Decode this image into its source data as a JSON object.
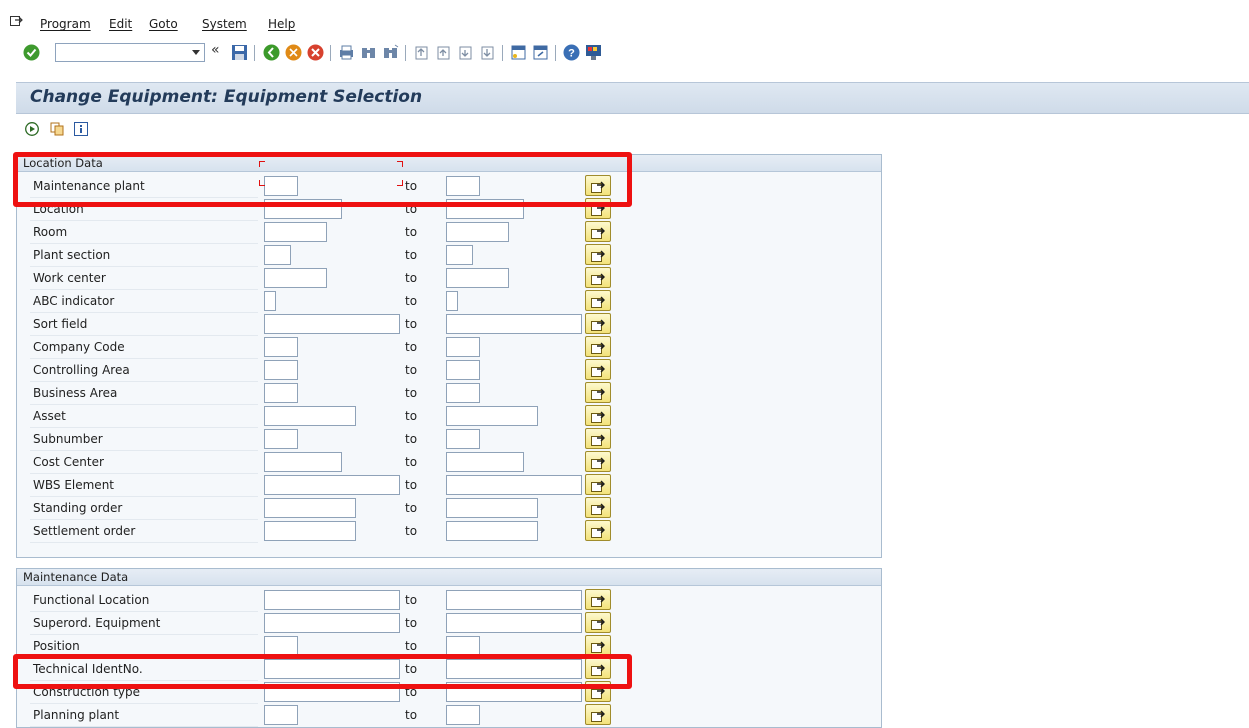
{
  "menu": [
    "Program",
    "Edit",
    "Goto",
    "System",
    "Help"
  ],
  "command_field": {
    "value": ""
  },
  "title": "Change Equipment: Equipment Selection",
  "to_label": "to",
  "location_group": {
    "title": "Location Data",
    "rows": [
      {
        "label": "Maintenance plant"
      },
      {
        "label": "Location"
      },
      {
        "label": "Room"
      },
      {
        "label": "Plant section"
      },
      {
        "label": "Work center"
      },
      {
        "label": "ABC indicator"
      },
      {
        "label": "Sort field"
      },
      {
        "label": "Company Code"
      },
      {
        "label": "Controlling Area"
      },
      {
        "label": "Business Area"
      },
      {
        "label": "Asset"
      },
      {
        "label": "Subnumber"
      },
      {
        "label": "Cost Center"
      },
      {
        "label": "WBS Element"
      },
      {
        "label": "Standing order"
      },
      {
        "label": "Settlement order"
      }
    ]
  },
  "maintenance_group": {
    "title": "Maintenance Data",
    "rows": [
      {
        "label": "Functional Location"
      },
      {
        "label": "Superord. Equipment"
      },
      {
        "label": "Position"
      },
      {
        "label": "Technical IdentNo."
      },
      {
        "label": "Construction type"
      },
      {
        "label": "Planning plant"
      }
    ]
  },
  "colors": {
    "highlight": "#ee1111",
    "title_text": "#233b5a",
    "multi_select_button": "#f3e27a"
  }
}
